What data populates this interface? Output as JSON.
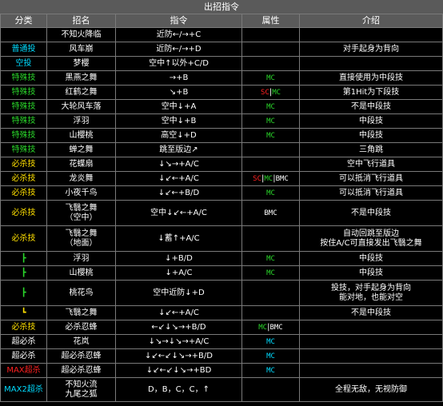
{
  "title": "出招指令",
  "headers": [
    "分类",
    "招名",
    "指令",
    "属性",
    "介绍"
  ],
  "colors": {
    "cyan": "#00dcff",
    "green": "#2ad62a",
    "yellow": "#ffe000",
    "red": "#ff2020",
    "white": "#ffffff",
    "header_bg": "#5a5a5a",
    "border": "#7a7a7a"
  },
  "rows": [
    {
      "h": 18,
      "cat": "",
      "catColor": "white",
      "name": "不知火降临",
      "cmd": "近防←/→+C",
      "attr": [],
      "desc": ""
    },
    {
      "h": 18,
      "cat": "普通投",
      "catColor": "cyan",
      "name": "风车崩",
      "cmd": "近防←/→+D",
      "attr": [],
      "desc": "对手起身为背向"
    },
    {
      "h": 18,
      "cat": "空投",
      "catColor": "cyan",
      "name": "梦樱",
      "cmd": "空中↑以外+C/D",
      "attr": [],
      "desc": ""
    },
    {
      "h": 18,
      "cat": "特殊技",
      "catColor": "green",
      "name": "黑燕之舞",
      "cmd": "→+B",
      "attr": [
        {
          "t": "MC",
          "c": "green"
        }
      ],
      "desc": "直接使用为中段技"
    },
    {
      "h": 18,
      "cat": "特殊技",
      "catColor": "green",
      "name": "红鹤之舞",
      "cmd": "↘+B",
      "attr": [
        {
          "t": "SC",
          "c": "red"
        },
        {
          "t": "MC",
          "c": "green"
        }
      ],
      "desc": "第1Hit为下段技"
    },
    {
      "h": 18,
      "cat": "特殊技",
      "catColor": "green",
      "name": "大轮风车落",
      "cmd": "空中↓+A",
      "attr": [
        {
          "t": "MC",
          "c": "green"
        }
      ],
      "desc": "不是中段技"
    },
    {
      "h": 18,
      "cat": "特殊技",
      "catColor": "green",
      "name": "浮羽",
      "cmd": "空中↓+B",
      "attr": [
        {
          "t": "MC",
          "c": "green"
        }
      ],
      "desc": "中段技"
    },
    {
      "h": 18,
      "cat": "特殊技",
      "catColor": "green",
      "name": "山樱桃",
      "cmd": "高空↓+D",
      "attr": [
        {
          "t": "MC",
          "c": "green"
        }
      ],
      "desc": "中段技"
    },
    {
      "h": 18,
      "cat": "特殊技",
      "catColor": "green",
      "name": "蝉之舞",
      "cmd": "跳至版边↗",
      "attr": [],
      "desc": "三角跳"
    },
    {
      "h": 18,
      "cat": "必杀技",
      "catColor": "yellow",
      "name": "花蝶扇",
      "cmd": "↓↘→+A/C",
      "attr": [],
      "desc": "空中飞行道具"
    },
    {
      "h": 18,
      "cat": "必杀技",
      "catColor": "yellow",
      "name": "龙炎舞",
      "cmd": "↓↙←+A/C",
      "attr": [
        {
          "t": "SC",
          "c": "red"
        },
        {
          "t": "MC",
          "c": "green"
        },
        {
          "t": "BMC",
          "c": "white"
        }
      ],
      "desc": "可以抵消飞行道具"
    },
    {
      "h": 18,
      "cat": "必杀技",
      "catColor": "yellow",
      "name": "小夜千鸟",
      "cmd": "↓↙←+B/D",
      "attr": [
        {
          "t": "MC",
          "c": "green"
        }
      ],
      "desc": "可以抵消飞行道具"
    },
    {
      "h": 32,
      "cat": "必杀技",
      "catColor": "yellow",
      "name": "飞翳之舞\n（空中）",
      "cmd": "空中↓↙←+A/C",
      "attr": [
        {
          "t": "BMC",
          "c": "white"
        }
      ],
      "desc": "不是中段技"
    },
    {
      "h": 32,
      "cat": "必杀技",
      "catColor": "yellow",
      "name": "飞翳之舞\n（地面）",
      "cmd": "↓蓄↑+A/C",
      "attr": [],
      "desc": "自动回跳至版边\n按住A/C可直接发出飞翳之舞"
    },
    {
      "h": 18,
      "cat": "┣",
      "catColor": "green",
      "name": "浮羽",
      "cmd": "↓+B/D",
      "attr": [
        {
          "t": "MC",
          "c": "green"
        }
      ],
      "desc": "中段技"
    },
    {
      "h": 18,
      "cat": "┣",
      "catColor": "green",
      "name": "山樱桃",
      "cmd": "↓+A/C",
      "attr": [
        {
          "t": "MC",
          "c": "green"
        }
      ],
      "desc": "中段技"
    },
    {
      "h": 32,
      "cat": "┣",
      "catColor": "green",
      "name": "桃花鸟",
      "cmd": "空中近防↓+D",
      "attr": [],
      "desc": "投技，对手起身为背向\n能对地，也能对空"
    },
    {
      "h": 18,
      "cat": "┗",
      "catColor": "yellow",
      "name": "飞翳之舞",
      "cmd": "↓↙←+A/C",
      "attr": [],
      "desc": "不是中段技"
    },
    {
      "h": 18,
      "cat": "必杀技",
      "catColor": "yellow",
      "name": "必杀忍蜂",
      "cmd": "←↙↓↘→+B/D",
      "attr": [
        {
          "t": "MC",
          "c": "green"
        },
        {
          "t": "BMC",
          "c": "white"
        }
      ],
      "desc": ""
    },
    {
      "h": 18,
      "cat": "超必杀",
      "catColor": "white",
      "name": "花岚",
      "cmd": "↓↘→↓↘→+A/C",
      "attr": [
        {
          "t": "MC",
          "c": "cyan"
        }
      ],
      "desc": ""
    },
    {
      "h": 18,
      "cat": "超必杀",
      "catColor": "white",
      "name": "超必杀忍蜂",
      "cmd": "↓↙←↙↓↘→+B/D",
      "attr": [
        {
          "t": "MC",
          "c": "cyan"
        }
      ],
      "desc": ""
    },
    {
      "h": 18,
      "cat": "MAX超杀",
      "catColor": "red",
      "name": "超必杀忍蜂",
      "cmd": "↓↙←↙↓↘→+BD",
      "attr": [
        {
          "t": "MC",
          "c": "cyan"
        }
      ],
      "desc": ""
    },
    {
      "h": 30,
      "cat": "MAX2超杀",
      "catColor": "cyan",
      "name": "不知火流\n九尾之狐",
      "cmd": "D，B，C，C，↑",
      "attr": [],
      "desc": "全程无敌，无视防御"
    }
  ]
}
